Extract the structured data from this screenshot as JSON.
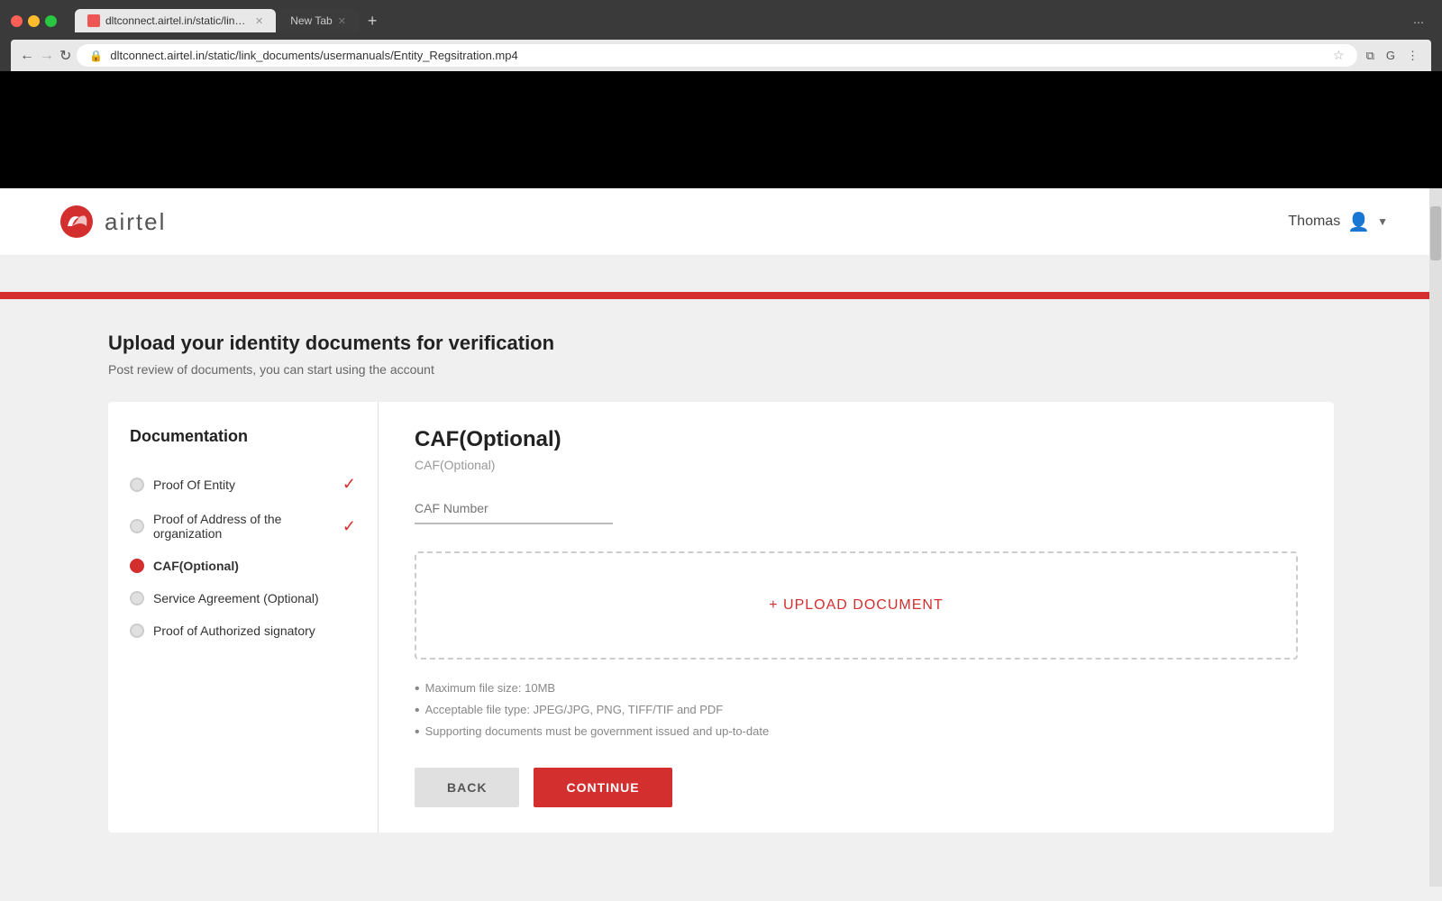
{
  "browser": {
    "tabs": [
      {
        "label": "dltconnect.airtel.in",
        "active": true,
        "icon": "red"
      },
      {
        "label": "New Tab",
        "active": false
      }
    ],
    "address": "dltconnect.airtel.in/static/link_documents/usermanuals/Entity_Regsitration.mp4",
    "back_btn": "←",
    "forward_btn": "→",
    "reload_btn": "↻"
  },
  "header": {
    "logo_text": "airtel",
    "user_name": "Thomas"
  },
  "page": {
    "title": "Upload your identity documents for verification",
    "subtitle": "Post review of documents, you can start using the account",
    "sidebar_title": "Documentation",
    "sidebar_items": [
      {
        "label": "Proof Of Entity",
        "state": "checked",
        "active": false
      },
      {
        "label": "Proof of Address of the organization",
        "state": "checked",
        "active": false
      },
      {
        "label": "CAF(Optional)",
        "state": "active",
        "active": true
      },
      {
        "label": "Service Agreement (Optional)",
        "state": "inactive",
        "active": false
      },
      {
        "label": "Proof of Authorized signatory",
        "state": "inactive",
        "active": false
      }
    ],
    "main": {
      "section_title": "CAF(Optional)",
      "section_subtitle": "CAF(Optional)",
      "caf_input_placeholder": "CAF Number",
      "upload_text": "+ UPLOAD DOCUMENT",
      "file_info": [
        "Maximum file size: 10MB",
        "Acceptable file type: JPEG/JPG, PNG, TIFF/TIF and PDF",
        "Supporting documents must be government issued and up-to-date"
      ],
      "back_button": "BACK",
      "continue_button": "CONTINUE"
    }
  }
}
